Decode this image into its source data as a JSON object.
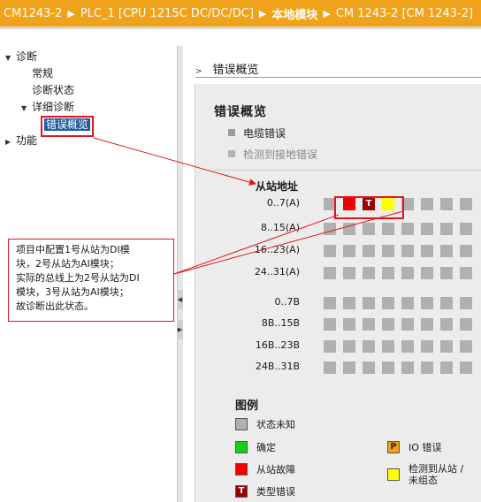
{
  "titlebar": {
    "crumbs": [
      "CM1243-2",
      "PLC_1 [CPU 1215C DC/DC/DC]",
      "本地模块",
      "CM 1243-2 [CM 1243-2]"
    ],
    "separator": "▶"
  },
  "tree": {
    "diagnosis": "诊断",
    "general": "常规",
    "diag_status": "诊断状态",
    "detail_diag": "详细诊断",
    "error_overview": "错误概览",
    "function": "功能"
  },
  "content": {
    "header": "错误概览",
    "panel_title": "错误概览",
    "cable_error": "电缆错误",
    "ground_error": "检测到接地错误",
    "slave_address": "从站地址",
    "rows": [
      {
        "label": "0..7(A)",
        "states": [
          "unknown",
          "fault",
          "type",
          "detect",
          "unknown",
          "unknown",
          "unknown",
          "unknown"
        ]
      },
      {
        "label": "8..15(A)",
        "states": [
          "unknown",
          "unknown",
          "unknown",
          "unknown",
          "unknown",
          "unknown",
          "unknown",
          "unknown"
        ]
      },
      {
        "label": "16..23(A)",
        "states": [
          "unknown",
          "unknown",
          "unknown",
          "unknown",
          "unknown",
          "unknown",
          "unknown",
          "unknown"
        ]
      },
      {
        "label": "24..31(A)",
        "states": [
          "unknown",
          "unknown",
          "unknown",
          "unknown",
          "unknown",
          "unknown",
          "unknown",
          "unknown"
        ]
      },
      {
        "label": "0..7B",
        "states": [
          "unknown",
          "unknown",
          "unknown",
          "unknown",
          "unknown",
          "unknown",
          "unknown",
          "unknown"
        ]
      },
      {
        "label": "8B..15B",
        "states": [
          "unknown",
          "unknown",
          "unknown",
          "unknown",
          "unknown",
          "unknown",
          "unknown",
          "unknown"
        ]
      },
      {
        "label": "16B..23B",
        "states": [
          "unknown",
          "unknown",
          "unknown",
          "unknown",
          "unknown",
          "unknown",
          "unknown",
          "unknown"
        ]
      },
      {
        "label": "24B..31B",
        "states": [
          "unknown",
          "unknown",
          "unknown",
          "unknown",
          "unknown",
          "unknown",
          "unknown",
          "unknown"
        ]
      }
    ],
    "type_marker": "T"
  },
  "legend": {
    "title": "图例",
    "unknown": "状态未知",
    "ok": "确定",
    "fault": "从站故障",
    "type_error": "类型错误",
    "io_error": "IO 错误",
    "io_marker": "P",
    "detect_line1": "检测到从站 /",
    "detect_line2": "未组态",
    "type_marker": "T"
  },
  "callout": {
    "lines": [
      "项目中配置1号从站为DI模",
      "块，2号从站为AI模块；",
      "实际的总线上为2号从站为DI",
      "模块，3号从站为AI模块；",
      "故诊断出此状态。"
    ]
  },
  "colors": {
    "titlebar": "#f0a31a",
    "unknown": "#b0b0b0",
    "ok": "#19d019",
    "fault": "#f00000",
    "type_error": "#9b0000",
    "io_error": "#f0a31a",
    "detect": "#ffff00",
    "annotation": "#e0161c",
    "selected": "#1f5b9e"
  },
  "icons": {
    "expanded": "triangle-down-icon",
    "collapsed": "triangle-right-icon",
    "header_chevron": "chevron-right-icon"
  }
}
